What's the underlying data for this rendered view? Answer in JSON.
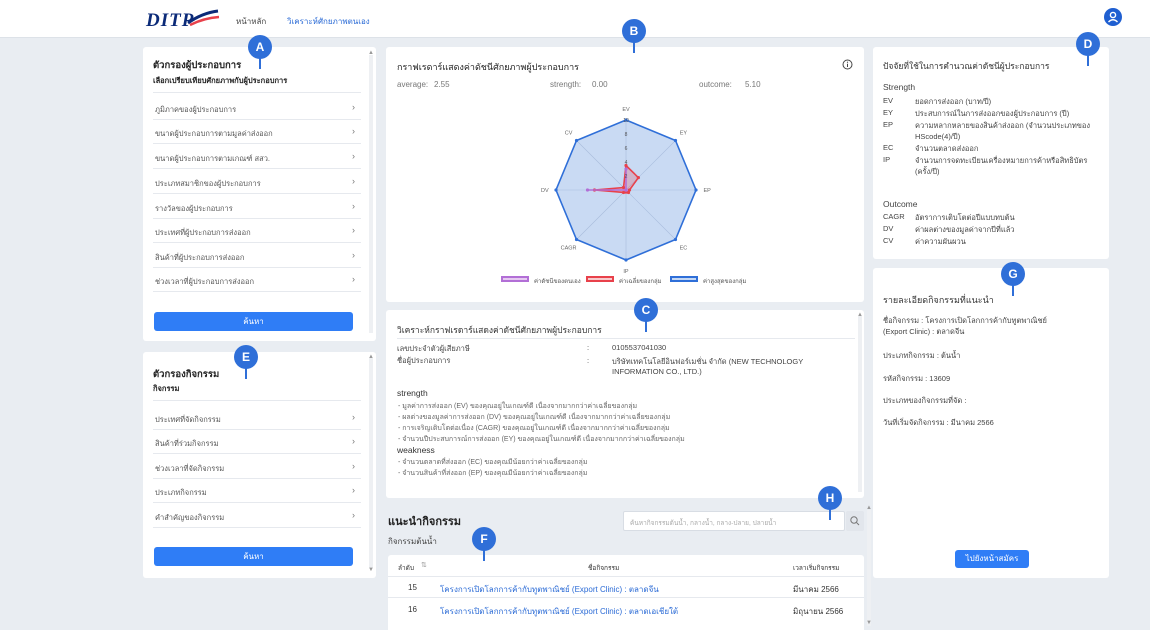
{
  "header": {
    "logo": "DITP",
    "nav": [
      {
        "label": "หน้าหลัก",
        "active": false
      },
      {
        "label": "วิเคราะห์ศักยภาพตนเอง",
        "active": true
      }
    ]
  },
  "markers": {
    "a": "A",
    "b": "B",
    "c": "C",
    "d": "D",
    "e": "E",
    "f": "F",
    "g": "G",
    "h": "H"
  },
  "exporter_filter": {
    "title": "ตัวกรองผู้ประกอบการ",
    "subtitle": "เลือกเปรียบเทียบศักยภาพกับผู้ประกอบการ",
    "items": [
      "ภูมิภาคของผู้ประกอบการ",
      "ขนาดผู้ประกอบการตามมูลค่าส่งออก",
      "ขนาดผู้ประกอบการตามเกณฑ์ สสว.",
      "ประเภทสมาชิกของผู้ประกอบการ",
      "รางวัลของผู้ประกอบการ",
      "ประเทศที่ผู้ประกอบการส่งออก",
      "สินค้าที่ผู้ประกอบการส่งออก",
      "ช่วงเวลาที่ผู้ประกอบการส่งออก"
    ],
    "search_button": "ค้นหา"
  },
  "activity_filter": {
    "title": "ตัวกรองกิจกรรม",
    "subtitle": "กิจกรรม",
    "items": [
      "ประเทศที่จัดกิจกรรม",
      "สินค้าที่ร่วมกิจกรรม",
      "ช่วงเวลาที่จัดกิจกรรม",
      "ประเภทกิจกรรม",
      "คำสำคัญของกิจกรรม"
    ],
    "search_button": "ค้นหา"
  },
  "radar": {
    "title": "กราฟเรดาร์แสดงค่าดัชนีศักยภาพผู้ประกอบการ",
    "stats": {
      "average_label": "average:",
      "average": "2.55",
      "strength_label": "strength:",
      "strength": "0.00",
      "outcome_label": "outcome:",
      "outcome": "5.10"
    },
    "legend": [
      "ค่าดัชนีของตนเอง",
      "ค่าเฉลี่ยของกลุ่ม",
      "ค่าสูงสุดของกลุ่ม"
    ],
    "colors": {
      "self": "#b26fd6",
      "avg": "#e8414b",
      "max": "#2f6fd8"
    }
  },
  "chart_data": {
    "type": "radar",
    "axes": [
      "EV",
      "EY",
      "EP",
      "EC",
      "IP",
      "CAGR",
      "DV",
      "CV"
    ],
    "rlim": [
      0,
      10
    ],
    "ticks": [
      "2",
      "4",
      "6",
      "8",
      "10"
    ],
    "series": [
      {
        "name": "ค่าดัชนีของตนเอง",
        "values": [
          3,
          0,
          0,
          0,
          0,
          0,
          5.5,
          0
        ]
      },
      {
        "name": "ค่าเฉลี่ยของกลุ่ม",
        "values": [
          3.5,
          2.5,
          0.5,
          0.5,
          0.3,
          0.5,
          4.5,
          0.5
        ]
      },
      {
        "name": "ค่าสูงสุดของกลุ่ม",
        "values": [
          10,
          10,
          10,
          10,
          10,
          10,
          10,
          10
        ]
      }
    ]
  },
  "analysis": {
    "title": "วิเคราะห์กราฟเรดาร์แสดงค่าดัชนีศักยภาพผู้ประกอบการ",
    "tax_id_label": "เลขประจำตัวผู้เสียภาษี",
    "tax_id": "0105537041030",
    "company_label": "ชื่อผู้ประกอบการ",
    "company_line1": "บริษัทเทคโนโลยีอินฟอร์เมชั่น จำกัด (NEW TECHNOLOGY",
    "company_line2": "INFORMATION CO., LTD.)",
    "colon": ":",
    "strength_heading": "strength",
    "strengths": [
      "- มูลค่าการส่งออก (EV) ของคุณอยู่ในเกณฑ์ดี เนื่องจากมากกว่าค่าเฉลี่ยของกลุ่ม",
      "- ผลต่างของมูลค่าการส่งออก (DV) ของคุณอยู่ในเกณฑ์ดี เนื่องจากมากกว่าค่าเฉลี่ยของกลุ่ม",
      "- การเจริญเติบโตต่อเนื่อง (CAGR) ของคุณอยู่ในเกณฑ์ดี เนื่องจากมากกว่าค่าเฉลี่ยของกลุ่ม",
      "- จำนวนปีประสบการณ์การส่งออก (EY) ของคุณอยู่ในเกณฑ์ดี เนื่องจากมากกว่าค่าเฉลี่ยของกลุ่ม"
    ],
    "weakness_heading": "weakness",
    "weaknesses": [
      "- จำนวนตลาดที่ส่งออก (EC) ของคุณมีน้อยกว่าค่าเฉลี่ยของกลุ่ม",
      "- จำนวนสินค้าที่ส่งออก (EP) ของคุณมีน้อยกว่าค่าเฉลี่ยของกลุ่ม"
    ]
  },
  "factors": {
    "title": "ปัจจัยที่ใช้ในการคำนวณค่าดัชนีผู้ประกอบการ",
    "strength_heading": "Strength",
    "strength_items": [
      {
        "key": "EV",
        "desc": "ยอดการส่งออก (บาท/ปี)"
      },
      {
        "key": "EY",
        "desc": "ประสบการณ์ในการส่งออกของผู้ประกอบการ (ปี)"
      },
      {
        "key": "EP",
        "desc": "ความหลากหลายของสินค้าส่งออก (จำนวนประเภทของ HScode(4)/ปี)"
      },
      {
        "key": "EC",
        "desc": "จำนวนตลาดส่งออก"
      },
      {
        "key": "IP",
        "desc": "จำนวนการจดทะเบียนเครื่องหมายการค้าหรือสิทธิบัตร (ครั้ง/ปี)"
      }
    ],
    "outcome_heading": "Outcome",
    "outcome_items": [
      {
        "key": "CAGR",
        "desc": "อัตราการเติบโตต่อปีแบบทบต้น"
      },
      {
        "key": "DV",
        "desc": "ค่าผลต่างของมูลค่าจากปีที่แล้ว"
      },
      {
        "key": "CV",
        "desc": "ค่าความผันผวน"
      }
    ]
  },
  "activity_detail": {
    "title": "รายละเอียดกิจกรรมที่แนะนำ",
    "name_line1": "ชื่อกิจกรรม : โครงการเปิดโลกการค้ากับทูตพาณิชย์",
    "name_line2": "(Export Clinic) : ตลาดจีน",
    "type": "ประเภทกิจกรรม : ต้นน้ำ",
    "code": "รหัสกิจกรรม : 13609",
    "org": "ประเภทของกิจกรรมที่จัด :",
    "start": "วันที่เริ่มจัดกิจกรรม : มีนาคม 2566",
    "register_button": "ไปยังหน้าสมัคร"
  },
  "recommend": {
    "title": "แนะนำกิจกรรม",
    "subtitle": "กิจกรรมต้นน้ำ",
    "search_placeholder": "ค้นหากิจกรรมต้นน้ำ, กลางน้ำ, กลาง-ปลาย, ปลายน้ำ",
    "columns": [
      "ลำดับ",
      "ชื่อกิจกรรม",
      "เวลาเริ่มกิจกรรม"
    ],
    "rows": [
      {
        "no": "15",
        "name": "โครงการเปิดโลกการค้ากับทูตพาณิชย์ (Export Clinic) : ตลาดจีน",
        "date": "มีนาคม 2566"
      },
      {
        "no": "16",
        "name": "โครงการเปิดโลกการค้ากับทูตพาณิชย์ (Export Clinic) : ตลาดเอเชียใต้",
        "date": "มิถุนายน 2566"
      }
    ]
  }
}
